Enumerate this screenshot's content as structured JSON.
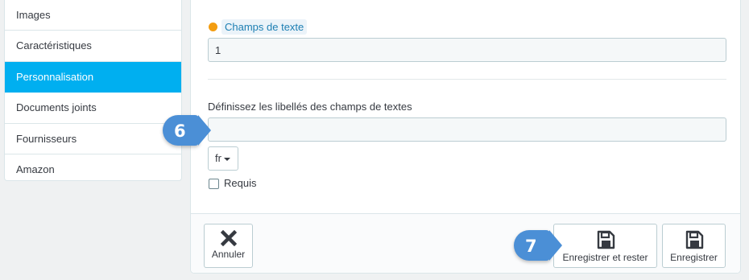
{
  "sidebar": {
    "items": [
      {
        "label": "Images"
      },
      {
        "label": "Caractéristiques"
      },
      {
        "label": "Personnalisation",
        "active": true
      },
      {
        "label": "Documents joints"
      },
      {
        "label": "Fournisseurs"
      },
      {
        "label": "Amazon"
      }
    ]
  },
  "form": {
    "text_fields": {
      "label": "Champs de texte",
      "value": "1",
      "status_color": "#f39d11"
    },
    "labels_section": {
      "label": "Définissez les libellés des champs de textes",
      "value": "",
      "language": "fr",
      "required_label": "Requis",
      "required_checked": false
    }
  },
  "footer": {
    "cancel_label": "Annuler",
    "save_stay_label": "Enregistrer et rester",
    "save_label": "Enregistrer"
  },
  "annotations": {
    "step6": "6",
    "step7": "7"
  },
  "colors": {
    "accent": "#00aff0",
    "badge": "#4b8fd6"
  }
}
